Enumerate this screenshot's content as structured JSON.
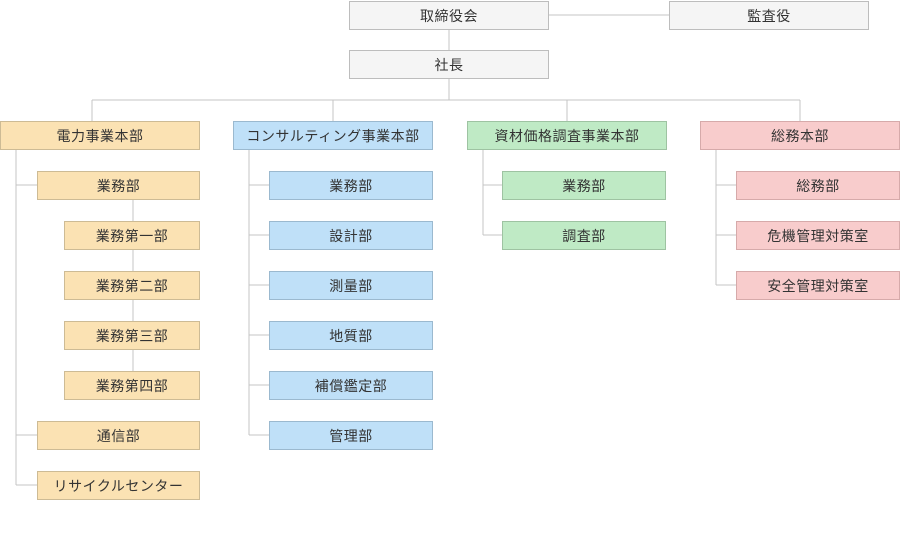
{
  "top": {
    "board": "取締役会",
    "auditor": "監査役",
    "president": "社長"
  },
  "divisions": [
    {
      "name": "電力事業本部",
      "color": "#fbe2b3",
      "departments": [
        "業務部",
        "通信部",
        "リサイクルセンター"
      ],
      "sub_departments": [
        "業務第一部",
        "業務第二部",
        "業務第三部",
        "業務第四部"
      ]
    },
    {
      "name": "コンサルティング事業本部",
      "color": "#bfe0f8",
      "departments": [
        "業務部",
        "設計部",
        "測量部",
        "地質部",
        "補償鑑定部",
        "管理部"
      ]
    },
    {
      "name": "資材価格調査事業本部",
      "color": "#bfeac5",
      "departments": [
        "業務部",
        "調査部"
      ]
    },
    {
      "name": "総務本部",
      "color": "#f8cccc",
      "departments": [
        "総務部",
        "危機管理対策室",
        "安全管理対策室"
      ]
    }
  ]
}
